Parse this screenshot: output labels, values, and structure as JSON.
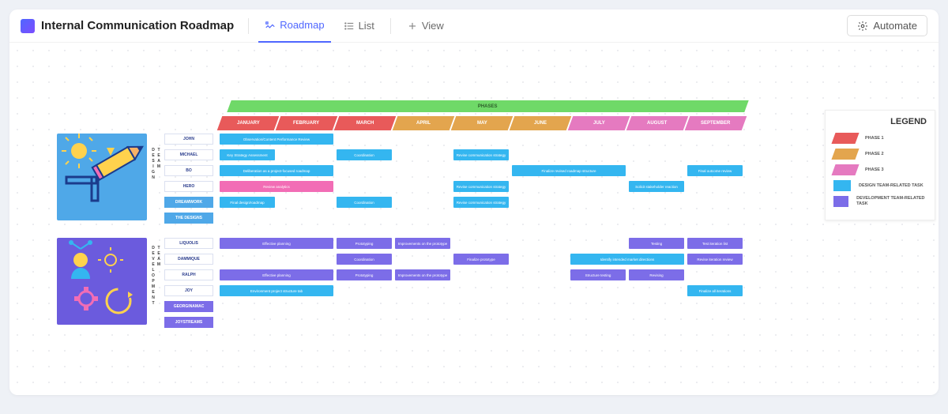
{
  "header": {
    "title": "Internal Communication Roadmap",
    "tabs": {
      "roadmap": "Roadmap",
      "list": "List",
      "view": "View"
    },
    "automate": "Automate"
  },
  "phases_label": "PHASES",
  "months": [
    {
      "label": "JANUARY",
      "color": "#e85a5a"
    },
    {
      "label": "FEBRUARY",
      "color": "#e85a5a"
    },
    {
      "label": "MARCH",
      "color": "#e85a5a"
    },
    {
      "label": "APRIL",
      "color": "#e3a54e"
    },
    {
      "label": "MAY",
      "color": "#e3a54e"
    },
    {
      "label": "JUNE",
      "color": "#e3a54e"
    },
    {
      "label": "JULY",
      "color": "#e57ac0"
    },
    {
      "label": "AUGUST",
      "color": "#e57ac0"
    },
    {
      "label": "SEPTEMBER",
      "color": "#e57ac0"
    }
  ],
  "team_labels": {
    "design": "DESIGN TEAM",
    "dev": "DEVELOPMENT TEAM"
  },
  "design_names": [
    "JOHN",
    "MICHAEL",
    "BO",
    "HERO",
    "DREAMWORK",
    "THE DESIGNS"
  ],
  "dev_names": [
    "LIQUOLIS",
    "DAMMIQUE",
    "RALPH",
    "JOY",
    "GEORGINAMAC",
    "JOYSTREAMS"
  ],
  "design_tasks": [
    [
      {
        "start": 0,
        "span": 2,
        "label": "Observation/Content Performance Review",
        "color": "c-blue"
      }
    ],
    [
      {
        "start": 0,
        "span": 1,
        "label": "Key Strategy Assessment",
        "color": "c-blue"
      },
      {
        "start": 2,
        "span": 1,
        "label": "Coordination",
        "color": "c-blue"
      },
      {
        "start": 4,
        "span": 1,
        "label": "Revise communication strategy",
        "color": "c-blue"
      }
    ],
    [
      {
        "start": 0,
        "span": 2,
        "label": "Deliberation as a project-focused roadmap",
        "color": "c-blue"
      },
      {
        "start": 5,
        "span": 2,
        "label": "Finalize revised roadmap structure",
        "color": "c-blue"
      },
      {
        "start": 8,
        "span": 1,
        "label": "Final outcome review",
        "color": "c-blue"
      }
    ],
    [
      {
        "start": 0,
        "span": 2,
        "label": "Review analytics",
        "color": "c-pink"
      },
      {
        "start": 4,
        "span": 1,
        "label": "Revise communication strategy",
        "color": "c-blue"
      },
      {
        "start": 7,
        "span": 1,
        "label": "Solicit stakeholder reaction",
        "color": "c-blue"
      }
    ],
    [
      {
        "start": 0,
        "span": 1,
        "label": "Final design/roadmap",
        "color": "c-blue"
      },
      {
        "start": 2,
        "span": 1,
        "label": "Coordination",
        "color": "c-blue"
      },
      {
        "start": 4,
        "span": 1,
        "label": "Revise communication strategy",
        "color": "c-blue"
      }
    ],
    []
  ],
  "dev_tasks": [
    [
      {
        "start": 0,
        "span": 2,
        "label": "Effective planning",
        "color": "c-purple"
      },
      {
        "start": 2,
        "span": 1,
        "label": "Prototyping",
        "color": "c-purple"
      },
      {
        "start": 3,
        "span": 1,
        "label": "Improvements on the prototype",
        "color": "c-purple"
      },
      {
        "start": 7,
        "span": 1,
        "label": "Testing",
        "color": "c-purple"
      },
      {
        "start": 8,
        "span": 1,
        "label": "Test iteration list",
        "color": "c-purple"
      }
    ],
    [
      {
        "start": 2,
        "span": 1,
        "label": "Coordination",
        "color": "c-purple"
      },
      {
        "start": 4,
        "span": 1,
        "label": "Finalize prototype",
        "color": "c-purple"
      },
      {
        "start": 6,
        "span": 2,
        "label": "Identify intended market directions",
        "color": "c-blue"
      },
      {
        "start": 8,
        "span": 1,
        "label": "Revise iteration review",
        "color": "c-purple"
      }
    ],
    [
      {
        "start": 0,
        "span": 2,
        "label": "Effective planning",
        "color": "c-purple"
      },
      {
        "start": 2,
        "span": 1,
        "label": "Prototyping",
        "color": "c-purple"
      },
      {
        "start": 3,
        "span": 1,
        "label": "Improvements on the prototype",
        "color": "c-purple"
      },
      {
        "start": 6,
        "span": 1,
        "label": "Structure testing",
        "color": "c-purple"
      },
      {
        "start": 7,
        "span": 1,
        "label": "Revising",
        "color": "c-purple"
      }
    ],
    [
      {
        "start": 0,
        "span": 2,
        "label": "Environment project structure tab",
        "color": "c-blue"
      },
      {
        "start": 8,
        "span": 1,
        "label": "Finalize all iterations",
        "color": "c-blue"
      }
    ],
    [],
    []
  ],
  "legend": {
    "title": "LEGEND",
    "items": [
      {
        "label": "PHASE 1",
        "color": "#e85a5a",
        "shape": "skew"
      },
      {
        "label": "PHASE 2",
        "color": "#e3a54e",
        "shape": "skew"
      },
      {
        "label": "PHASE 3",
        "color": "#e57ac0",
        "shape": "skew"
      },
      {
        "label": "DESIGN TEAM-RELATED TASK",
        "color": "#34b6f0",
        "shape": "sq"
      },
      {
        "label": "DEVELOPMENT TEAM-RELATED TASK",
        "color": "#7c6de8",
        "shape": "sq"
      }
    ]
  }
}
